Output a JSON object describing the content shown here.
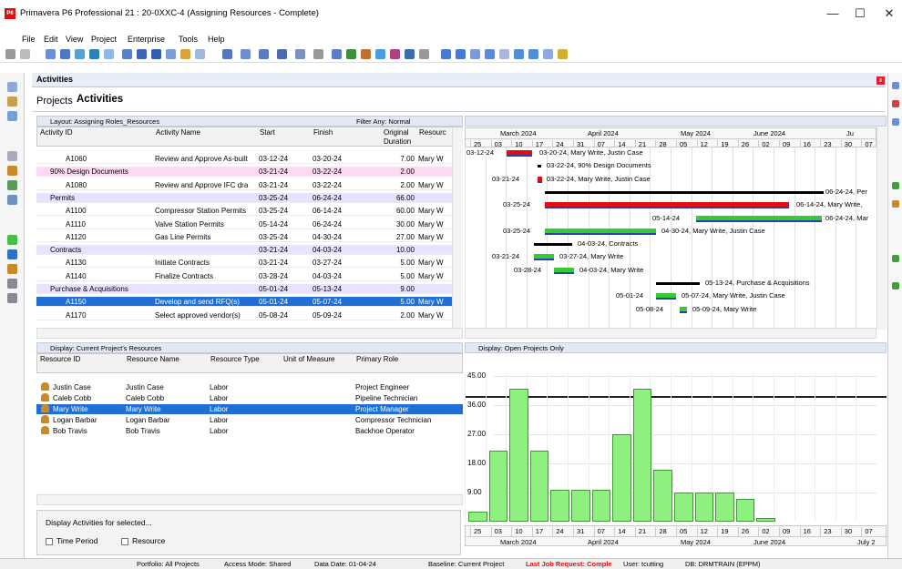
{
  "window": {
    "title": "Primavera P6 Professional 21 : 20-0XXC-4 (Assigning Resources - Complete)",
    "logo_text": "P6",
    "minimize": "—",
    "maximize": "☐",
    "close": "✕"
  },
  "menu": {
    "file": "File",
    "edit": "Edit",
    "view": "View",
    "project": "Project",
    "enterprise": "Enterprise",
    "tools": "Tools",
    "help": "Help"
  },
  "pane": {
    "title": "Activities"
  },
  "tabs": {
    "projects": "Projects",
    "activities": "Activities"
  },
  "layout_bar": {
    "layout": "Layout: Assigning Roles_Resources",
    "filter": "Filter Any: Normal"
  },
  "columns": {
    "activity_id": "Activity ID",
    "activity_name": "Activity Name",
    "start": "Start",
    "finish": "Finish",
    "original_duration_1": "Original",
    "original_duration_2": "Duration",
    "resources": "Resourc"
  },
  "rows": [
    {
      "id": "A1060",
      "name": "Review and Approve As-built",
      "start": "03-12-24",
      "finish": "03-20-24",
      "dur": "7.00",
      "res": "Mary W",
      "kind": "act"
    },
    {
      "id": "90% Design Documents",
      "name": "",
      "start": "03-21-24",
      "finish": "03-22-24",
      "dur": "2.00",
      "res": "",
      "kind": "wbs2"
    },
    {
      "id": "A1080",
      "name": "Review and Approve IFC dra",
      "start": "03-21-24",
      "finish": "03-22-24",
      "dur": "2.00",
      "res": "Mary W",
      "kind": "act"
    },
    {
      "id": "Permits",
      "name": "",
      "start": "03-25-24",
      "finish": "06-24-24",
      "dur": "66.00",
      "res": "",
      "kind": "wbs"
    },
    {
      "id": "A1100",
      "name": "Compressor Station Permits",
      "start": "03-25-24",
      "finish": "06-14-24",
      "dur": "60.00",
      "res": "Mary W",
      "kind": "act"
    },
    {
      "id": "A1110",
      "name": "Valve Station Permits",
      "start": "05-14-24",
      "finish": "06-24-24",
      "dur": "30.00",
      "res": "Mary W",
      "kind": "act"
    },
    {
      "id": "A1120",
      "name": "Gas Line Permits",
      "start": "03-25-24",
      "finish": "04-30-24",
      "dur": "27.00",
      "res": "Mary W",
      "kind": "act"
    },
    {
      "id": "Contracts",
      "name": "",
      "start": "03-21-24",
      "finish": "04-03-24",
      "dur": "10.00",
      "res": "",
      "kind": "wbs"
    },
    {
      "id": "A1130",
      "name": "Initiate Contracts",
      "start": "03-21-24",
      "finish": "03-27-24",
      "dur": "5.00",
      "res": "Mary W",
      "kind": "act"
    },
    {
      "id": "A1140",
      "name": "Finalize Contracts",
      "start": "03-28-24",
      "finish": "04-03-24",
      "dur": "5.00",
      "res": "Mary W",
      "kind": "act"
    },
    {
      "id": "Purchase & Acquisitions",
      "name": "",
      "start": "05-01-24",
      "finish": "05-13-24",
      "dur": "9.00",
      "res": "",
      "kind": "wbs"
    },
    {
      "id": "A1150",
      "name": "Develop and send RFQ(s)",
      "start": "05-01-24",
      "finish": "05-07-24",
      "dur": "5.00",
      "res": "Mary W",
      "kind": "sel"
    },
    {
      "id": "A1170",
      "name": "Select approved vendor(s)",
      "start": "05-08-24",
      "finish": "05-09-24",
      "dur": "2.00",
      "res": "Mary W",
      "kind": "act"
    }
  ],
  "gantt": {
    "months": [
      "March 2024",
      "April 2024",
      "May 2024",
      "June 2024",
      "Ju"
    ],
    "weeks": [
      "25",
      "03",
      "10",
      "17",
      "24",
      "31",
      "07",
      "14",
      "21",
      "28",
      "05",
      "12",
      "19",
      "26",
      "02",
      "09",
      "16",
      "23",
      "30",
      "07"
    ],
    "labels": {
      "a1060_start": "03-12-24",
      "a1060": "03-20-24, Mary Write, Justin Case",
      "d90": "03-22-24, 90% Design Documents",
      "a1080_start": "03-21-24",
      "a1080": "03-22-24, Mary Write, Justin Case",
      "permits": "06-24-24, Per",
      "a1100_start": "03-25-24",
      "a1100": "06-14-24, Mary Write,",
      "a1110_start": "05-14-24",
      "a1110": "06-24-24, Mar",
      "a1120_start": "03-25-24",
      "a1120": "04-30-24, Mary Write, Justin Case",
      "contracts": "04-03-24, Contracts",
      "a1130_start": "03-21-24",
      "a1130": "03-27-24, Mary Write",
      "a1140_start": "03-28-24",
      "a1140": "04-03-24, Mary Write",
      "purchase": "05-13-24, Purchase & Acquisitions",
      "a1150_start": "05-01-24",
      "a1150": "05-07-24, Mary Write, Justin Case",
      "a1170_start": "05-08-24",
      "a1170": "05-09-24, Mary Write"
    }
  },
  "resources": {
    "display": "Display: Current Project's Resources",
    "headers": {
      "id": "Resource ID",
      "name": "Resource Name",
      "type": "Resource Type",
      "uom": "Unit of Measure",
      "role": "Primary Role"
    },
    "rows": [
      {
        "id": "Justin Case",
        "name": "Justin Case",
        "type": "Labor",
        "role": "Project Engineer"
      },
      {
        "id": "Caleb Cobb",
        "name": "Caleb Cobb",
        "type": "Labor",
        "role": "Pipeline Technician"
      },
      {
        "id": "Mary Write",
        "name": "Mary Write",
        "type": "Labor",
        "role": "Project Manager"
      },
      {
        "id": "Logan Barbar",
        "name": "Logan Barbar",
        "type": "Labor",
        "role": "Compressor Technician"
      },
      {
        "id": "Bob Travis",
        "name": "Bob Travis",
        "type": "Labor",
        "role": "Backhoe Operator"
      }
    ],
    "display_activities": "Display Activities for selected...",
    "time_period": "Time Period",
    "resource": "Resource"
  },
  "histogram": {
    "display": "Display: Open Projects Only",
    "y_ticks": [
      "45.00",
      "36.00",
      "27.00",
      "18.00",
      "9.00"
    ],
    "values": [
      3,
      22,
      41,
      22,
      10,
      10,
      10,
      27,
      41,
      16,
      9,
      9,
      9,
      7,
      1
    ]
  },
  "bottom_months": [
    "March 2024",
    "April 2024",
    "May 2024",
    "June 2024",
    "July 2"
  ],
  "status": {
    "portfolio": "Portfolio: All Projects",
    "access": "Access Mode: Shared",
    "data_date": "Data Date: 01-04-24",
    "baseline": "Baseline: Current Project",
    "last_job": "Last Job Request: Comple",
    "user": "User: tcutting",
    "db": "DB: DRMTRAIN (EPPM)"
  },
  "colors": {
    "selection": "#1f6fd6",
    "bar_red": "#e01010",
    "bar_green": "#33cc33",
    "bar_blue": "#2a3fb0",
    "hist_green": "#8ef07e"
  }
}
